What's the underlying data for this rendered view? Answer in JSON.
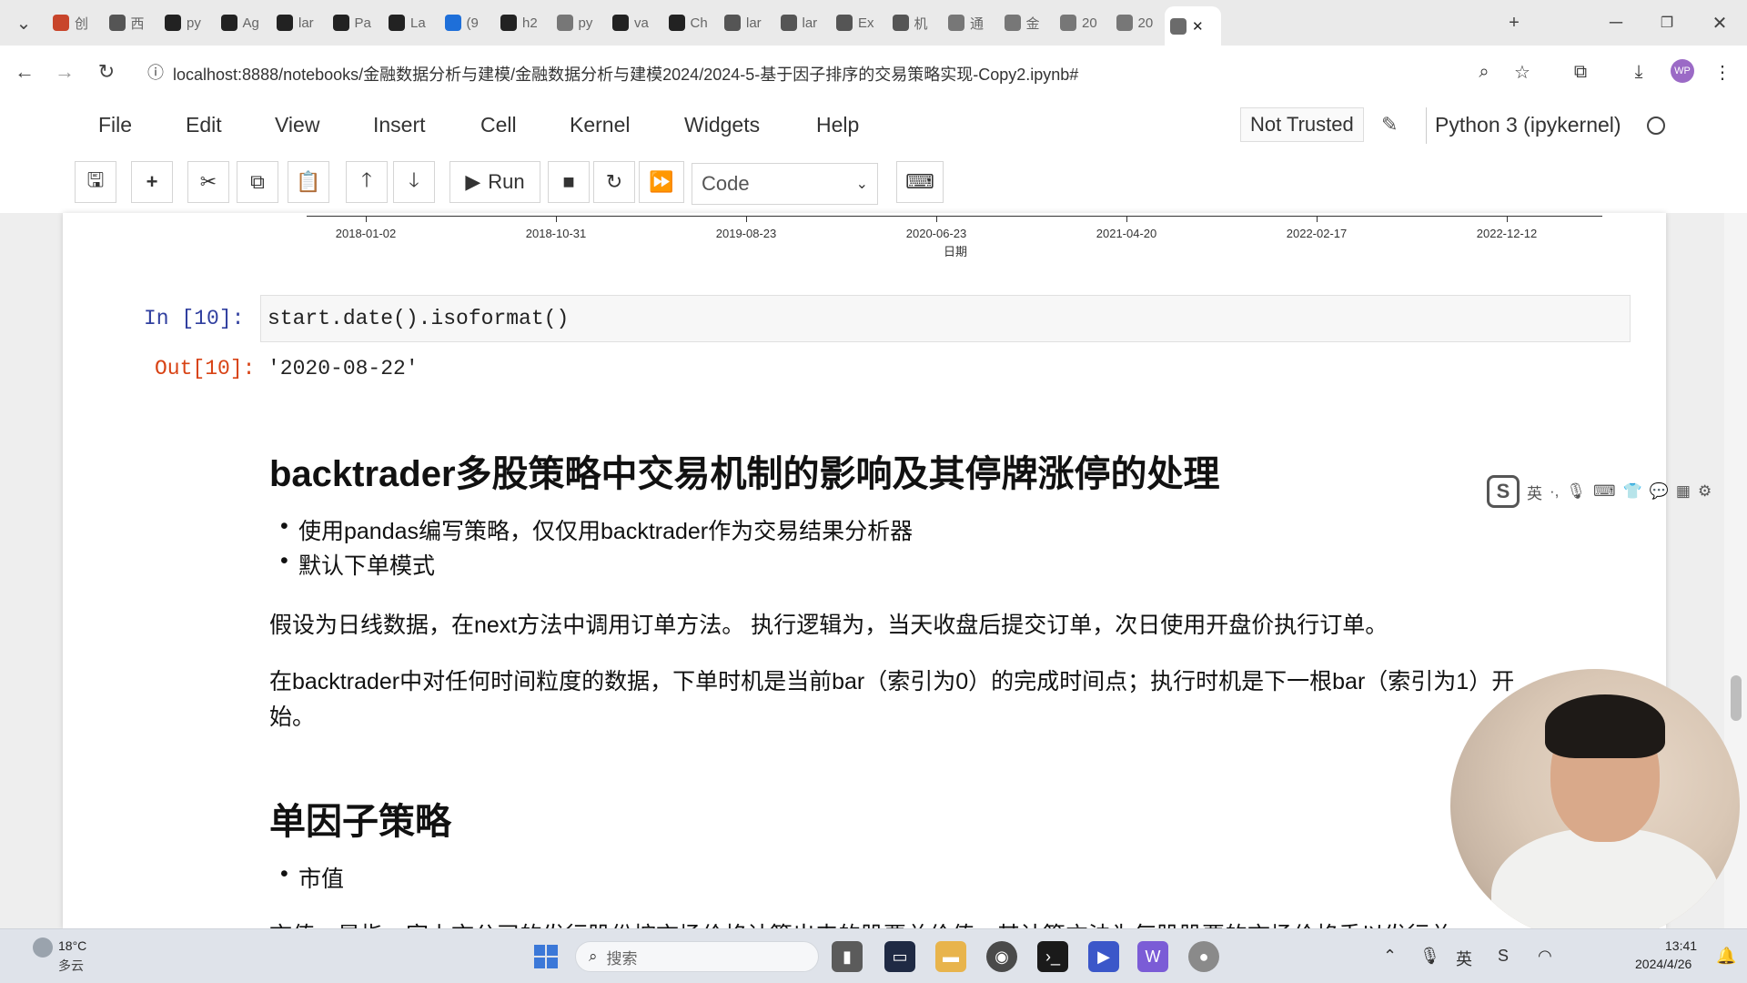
{
  "browser": {
    "tabs": [
      {
        "label": "创",
        "color": "#c8452b"
      },
      {
        "label": "西",
        "color": "#555555"
      },
      {
        "label": "py",
        "color": "#222222"
      },
      {
        "label": "Ag",
        "color": "#222222"
      },
      {
        "label": "lar",
        "color": "#222222"
      },
      {
        "label": "Pa",
        "color": "#222222"
      },
      {
        "label": "La",
        "color": "#222222"
      },
      {
        "label": "(9",
        "color": "#1e6fd9"
      },
      {
        "label": "h2",
        "color": "#222222"
      },
      {
        "label": "py",
        "color": "#777777"
      },
      {
        "label": "va",
        "color": "#222222"
      },
      {
        "label": "Ch",
        "color": "#222222"
      },
      {
        "label": "lar",
        "color": "#555555"
      },
      {
        "label": "lar",
        "color": "#555555"
      },
      {
        "label": "Ex",
        "color": "#555555"
      },
      {
        "label": "机",
        "color": "#555555"
      },
      {
        "label": "通",
        "color": "#777777"
      },
      {
        "label": "金",
        "color": "#777777"
      },
      {
        "label": "20",
        "color": "#777777"
      },
      {
        "label": "20",
        "color": "#777777"
      }
    ],
    "active_tab_close": "✕",
    "new_tab": "+",
    "url": "localhost:8888/notebooks/金融数据分析与建模/金融数据分析与建模2024/2024-5-基于因子排序的交易策略实现-Copy2.ipynb#",
    "avatar_text": "WP"
  },
  "jupyter": {
    "menus": [
      "File",
      "Edit",
      "View",
      "Insert",
      "Cell",
      "Kernel",
      "Widgets",
      "Help"
    ],
    "not_trusted": "Not Trusted",
    "kernel_name": "Python 3 (ipykernel)",
    "run_label": "Run",
    "cell_type": "Code"
  },
  "chart_axis": {
    "tick_labels": [
      "2018-01-02",
      "2018-10-31",
      "2019-08-23",
      "2020-06-23",
      "2021-04-20",
      "2022-02-17",
      "2022-12-12"
    ],
    "axis_title": "日期"
  },
  "cells": {
    "in_prompt": "In  [10]:",
    "code": "start.date().isoformat()",
    "out_prompt": "Out[10]:",
    "output": "'2020-08-22'"
  },
  "markdown": {
    "heading1": "backtrader多股策略中交易机制的影响及其停牌涨停的处理",
    "bullets1": [
      "使用pandas编写策略，仅仅用backtrader作为交易结果分析器",
      "默认下单模式"
    ],
    "para1": "假设为日线数据，在next方法中调用订单方法。 执行逻辑为，当天收盘后提交订单，次日使用开盘价执行订单。",
    "para2_line1": "在backtrader中对任何时间粒度的数据，下单时机是当前bar（索引为0）的完成时间点；执行时机是下一根bar（索引为1）开",
    "para2_line2": "始。",
    "heading2": "单因子策略",
    "bullets2": [
      "市值"
    ],
    "para3": "市值，是指一家上市公司的发行股份按市场价格计算出来的股票总价值，其计算方法为每股股票的市场价格乘以发行总"
  },
  "ime": {
    "lang": "英",
    "logo": "S"
  },
  "taskbar": {
    "temperature": "18°C",
    "condition": "多云",
    "search_placeholder": "搜索",
    "time": "13:41",
    "date": "2024/4/26",
    "ime_lang": "英"
  }
}
